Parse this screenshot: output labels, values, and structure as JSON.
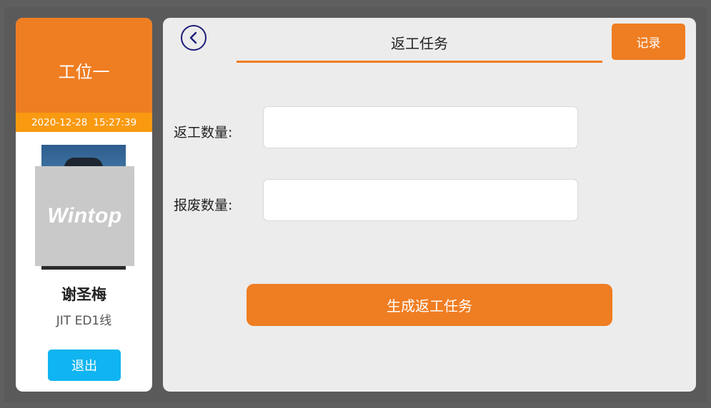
{
  "sidebar": {
    "station_title": "工位一",
    "date": "2020-12-28",
    "time": "15:27:39",
    "avatar_logo_text": "Wintop",
    "user_name": "谢圣梅",
    "user_line": "JIT ED1线",
    "logout_label": "退出"
  },
  "header": {
    "title": "返工任务",
    "records_label": "记录",
    "back_icon": "chevron-left-circle-icon"
  },
  "form": {
    "rework_qty_label": "返工数量:",
    "rework_qty_value": "",
    "scrap_qty_label": "报废数量:",
    "scrap_qty_value": "",
    "generate_label": "生成返工任务"
  },
  "colors": {
    "accent": "#ef7d22",
    "datetime_bar": "#f99a10",
    "logout": "#10b4f0",
    "back_icon": "#1e1e7a",
    "panel_bg": "#ececec",
    "frame_bg": "#5f5f5f"
  }
}
